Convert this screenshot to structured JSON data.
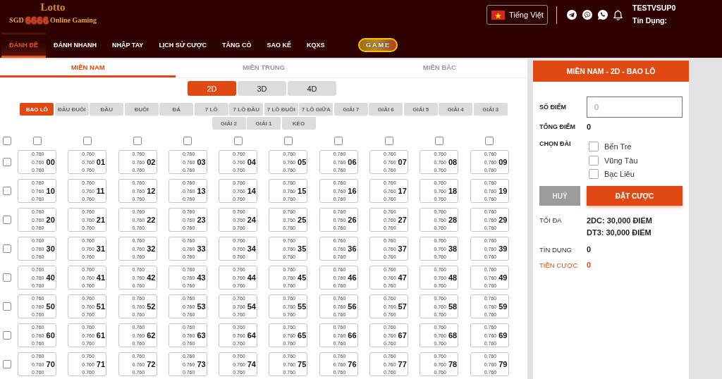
{
  "header": {
    "logo": {
      "title": "Lotto",
      "prefix": "SGD",
      "digits": "6666",
      "suffix": "Online Gaming"
    },
    "language": {
      "label": "Tiếng Việt"
    },
    "user": {
      "name": "TESTVSUP0",
      "credit": "Tín Dụng:"
    }
  },
  "nav": [
    {
      "label": "ĐÁNH ĐỀ",
      "kind": "link",
      "selected": true
    },
    {
      "label": "ĐÁNH NHANH",
      "kind": "link",
      "selected": false
    },
    {
      "label": "NHẬP TAY",
      "kind": "link",
      "selected": false
    },
    {
      "label": "LỊCH SỬ CƯỢC",
      "kind": "link",
      "selected": false
    },
    {
      "label": "TĂNG CÒ",
      "kind": "link",
      "selected": false
    },
    {
      "label": "SAO KÊ",
      "kind": "link",
      "selected": false
    },
    {
      "label": "KQXS",
      "kind": "link",
      "selected": false
    },
    {
      "label": "GAME",
      "kind": "pill",
      "selected": false
    }
  ],
  "regions": [
    {
      "label": "MIỀN NAM",
      "selected": true
    },
    {
      "label": "MIỀN TRUNG",
      "selected": false
    },
    {
      "label": "MIỀN BẮC",
      "selected": false
    }
  ],
  "digit_tabs": [
    {
      "label": "2D",
      "selected": true
    },
    {
      "label": "3D",
      "selected": false
    },
    {
      "label": "4D",
      "selected": false
    }
  ],
  "bet_types": [
    {
      "label": "BAO LÔ",
      "selected": true
    },
    {
      "label": "ĐẦU ĐUÔI",
      "selected": false
    },
    {
      "label": "ĐẦU",
      "selected": false
    },
    {
      "label": "ĐUÔI",
      "selected": false
    },
    {
      "label": "ĐÁ",
      "selected": false
    },
    {
      "label": "7 LÔ",
      "selected": false
    },
    {
      "label": "7 LÔ ĐẦU",
      "selected": false
    },
    {
      "label": "7 LÔ ĐUÔI",
      "selected": false
    },
    {
      "label": "7 LÔ GIỮA",
      "selected": false
    },
    {
      "label": "GIẢI 7",
      "selected": false
    },
    {
      "label": "GIẢI 6",
      "selected": false
    },
    {
      "label": "GIẢI 5",
      "selected": false
    },
    {
      "label": "GIẢI 4",
      "selected": false
    },
    {
      "label": "GIẢI 3",
      "selected": false
    },
    {
      "label": "GIẢI 2",
      "selected": false
    },
    {
      "label": "GIẢI 1",
      "selected": false
    },
    {
      "label": "KÉO",
      "selected": false
    }
  ],
  "grid": {
    "select_all": {
      "checked": false
    },
    "column_checks": [
      {
        "checked": false
      },
      {
        "checked": false
      },
      {
        "checked": false
      },
      {
        "checked": false
      },
      {
        "checked": false
      },
      {
        "checked": false
      },
      {
        "checked": false
      },
      {
        "checked": false
      },
      {
        "checked": false
      },
      {
        "checked": false
      }
    ],
    "rows": [
      {
        "checked": false,
        "cells": [
          {
            "odds": [
              "0.760",
              "0.760",
              "0.760"
            ],
            "number": "00"
          },
          {
            "odds": [
              "0.760",
              "0.760",
              "0.760"
            ],
            "number": "01"
          },
          {
            "odds": [
              "0.760",
              "0.760",
              "0.760"
            ],
            "number": "02"
          },
          {
            "odds": [
              "0.760",
              "0.760",
              "0.760"
            ],
            "number": "03"
          },
          {
            "odds": [
              "0.760",
              "0.760",
              "0.760"
            ],
            "number": "04"
          },
          {
            "odds": [
              "0.760",
              "0.760",
              "0.760"
            ],
            "number": "05"
          },
          {
            "odds": [
              "0.760",
              "0.760",
              "0.760"
            ],
            "number": "06"
          },
          {
            "odds": [
              "0.760",
              "0.760",
              "0.760"
            ],
            "number": "07"
          },
          {
            "odds": [
              "0.760",
              "0.760",
              "0.760"
            ],
            "number": "08"
          },
          {
            "odds": [
              "0.760",
              "0.760",
              "0.760"
            ],
            "number": "09"
          }
        ]
      },
      {
        "checked": false,
        "cells": [
          {
            "odds": [
              "0.760",
              "0.760",
              "0.760"
            ],
            "number": "10"
          },
          {
            "odds": [
              "0.760",
              "0.760",
              "0.760"
            ],
            "number": "11"
          },
          {
            "odds": [
              "0.760",
              "0.760",
              "0.760"
            ],
            "number": "12"
          },
          {
            "odds": [
              "0.760",
              "0.760",
              "0.760"
            ],
            "number": "13"
          },
          {
            "odds": [
              "0.760",
              "0.760",
              "0.760"
            ],
            "number": "14"
          },
          {
            "odds": [
              "0.760",
              "0.760",
              "0.760"
            ],
            "number": "15"
          },
          {
            "odds": [
              "0.760",
              "0.760",
              "0.760"
            ],
            "number": "16"
          },
          {
            "odds": [
              "0.760",
              "0.760",
              "0.760"
            ],
            "number": "17"
          },
          {
            "odds": [
              "0.760",
              "0.760",
              "0.760"
            ],
            "number": "18"
          },
          {
            "odds": [
              "0.760",
              "0.760",
              "0.760"
            ],
            "number": "19"
          }
        ]
      },
      {
        "checked": false,
        "cells": [
          {
            "odds": [
              "0.760",
              "0.760",
              "0.760"
            ],
            "number": "20"
          },
          {
            "odds": [
              "0.760",
              "0.760",
              "0.760"
            ],
            "number": "21"
          },
          {
            "odds": [
              "0.760",
              "0.760",
              "0.760"
            ],
            "number": "22"
          },
          {
            "odds": [
              "0.760",
              "0.760",
              "0.760"
            ],
            "number": "23"
          },
          {
            "odds": [
              "0.760",
              "0.760",
              "0.760"
            ],
            "number": "24"
          },
          {
            "odds": [
              "0.760",
              "0.760",
              "0.760"
            ],
            "number": "25"
          },
          {
            "odds": [
              "0.760",
              "0.760",
              "0.760"
            ],
            "number": "26"
          },
          {
            "odds": [
              "0.760",
              "0.760",
              "0.760"
            ],
            "number": "27"
          },
          {
            "odds": [
              "0.760",
              "0.760",
              "0.760"
            ],
            "number": "28"
          },
          {
            "odds": [
              "0.760",
              "0.760",
              "0.760"
            ],
            "number": "29"
          }
        ]
      },
      {
        "checked": false,
        "cells": [
          {
            "odds": [
              "0.760",
              "0.760",
              "0.760"
            ],
            "number": "30"
          },
          {
            "odds": [
              "0.760",
              "0.760",
              "0.760"
            ],
            "number": "31"
          },
          {
            "odds": [
              "0.760",
              "0.760",
              "0.760"
            ],
            "number": "32"
          },
          {
            "odds": [
              "0.760",
              "0.760",
              "0.760"
            ],
            "number": "33"
          },
          {
            "odds": [
              "0.760",
              "0.760",
              "0.760"
            ],
            "number": "34"
          },
          {
            "odds": [
              "0.760",
              "0.760",
              "0.760"
            ],
            "number": "35"
          },
          {
            "odds": [
              "0.760",
              "0.760",
              "0.760"
            ],
            "number": "36"
          },
          {
            "odds": [
              "0.760",
              "0.760",
              "0.760"
            ],
            "number": "37"
          },
          {
            "odds": [
              "0.760",
              "0.760",
              "0.760"
            ],
            "number": "38"
          },
          {
            "odds": [
              "0.760",
              "0.760",
              "0.760"
            ],
            "number": "39"
          }
        ]
      },
      {
        "checked": false,
        "cells": [
          {
            "odds": [
              "0.760",
              "0.760",
              "0.760"
            ],
            "number": "40"
          },
          {
            "odds": [
              "0.760",
              "0.760",
              "0.760"
            ],
            "number": "41"
          },
          {
            "odds": [
              "0.760",
              "0.760",
              "0.760"
            ],
            "number": "42"
          },
          {
            "odds": [
              "0.760",
              "0.760",
              "0.760"
            ],
            "number": "43"
          },
          {
            "odds": [
              "0.760",
              "0.760",
              "0.760"
            ],
            "number": "44"
          },
          {
            "odds": [
              "0.760",
              "0.760",
              "0.760"
            ],
            "number": "45"
          },
          {
            "odds": [
              "0.760",
              "0.760",
              "0.760"
            ],
            "number": "46"
          },
          {
            "odds": [
              "0.760",
              "0.760",
              "0.760"
            ],
            "number": "47"
          },
          {
            "odds": [
              "0.760",
              "0.760",
              "0.760"
            ],
            "number": "48"
          },
          {
            "odds": [
              "0.760",
              "0.760",
              "0.760"
            ],
            "number": "49"
          }
        ]
      },
      {
        "checked": false,
        "cells": [
          {
            "odds": [
              "0.760",
              "0.760",
              "0.760"
            ],
            "number": "50"
          },
          {
            "odds": [
              "0.760",
              "0.760",
              "0.760"
            ],
            "number": "51"
          },
          {
            "odds": [
              "0.760",
              "0.760",
              "0.760"
            ],
            "number": "52"
          },
          {
            "odds": [
              "0.760",
              "0.760",
              "0.760"
            ],
            "number": "53"
          },
          {
            "odds": [
              "0.760",
              "0.760",
              "0.760"
            ],
            "number": "54"
          },
          {
            "odds": [
              "0.760",
              "0.760",
              "0.760"
            ],
            "number": "55"
          },
          {
            "odds": [
              "0.760",
              "0.760",
              "0.760"
            ],
            "number": "56"
          },
          {
            "odds": [
              "0.760",
              "0.760",
              "0.760"
            ],
            "number": "57"
          },
          {
            "odds": [
              "0.760",
              "0.760",
              "0.760"
            ],
            "number": "58"
          },
          {
            "odds": [
              "0.760",
              "0.760",
              "0.760"
            ],
            "number": "59"
          }
        ]
      },
      {
        "checked": false,
        "cells": [
          {
            "odds": [
              "0.760",
              "0.760",
              "0.760"
            ],
            "number": "60"
          },
          {
            "odds": [
              "0.760",
              "0.760",
              "0.760"
            ],
            "number": "61"
          },
          {
            "odds": [
              "0.760",
              "0.760",
              "0.760"
            ],
            "number": "62"
          },
          {
            "odds": [
              "0.760",
              "0.760",
              "0.760"
            ],
            "number": "63"
          },
          {
            "odds": [
              "0.760",
              "0.760",
              "0.760"
            ],
            "number": "64"
          },
          {
            "odds": [
              "0.760",
              "0.760",
              "0.760"
            ],
            "number": "65"
          },
          {
            "odds": [
              "0.760",
              "0.760",
              "0.760"
            ],
            "number": "66"
          },
          {
            "odds": [
              "0.760",
              "0.760",
              "0.760"
            ],
            "number": "67"
          },
          {
            "odds": [
              "0.760",
              "0.760",
              "0.760"
            ],
            "number": "68"
          },
          {
            "odds": [
              "0.760",
              "0.760",
              "0.760"
            ],
            "number": "69"
          }
        ]
      },
      {
        "checked": false,
        "cells": [
          {
            "odds": [
              "0.760",
              "0.760",
              "0.760"
            ],
            "number": "70"
          },
          {
            "odds": [
              "0.760",
              "0.760",
              "0.760"
            ],
            "number": "71"
          },
          {
            "odds": [
              "0.760",
              "0.760",
              "0.760"
            ],
            "number": "72"
          },
          {
            "odds": [
              "0.760",
              "0.760",
              "0.760"
            ],
            "number": "73"
          },
          {
            "odds": [
              "0.760",
              "0.760",
              "0.760"
            ],
            "number": "74"
          },
          {
            "odds": [
              "0.760",
              "0.760",
              "0.760"
            ],
            "number": "75"
          },
          {
            "odds": [
              "0.760",
              "0.760",
              "0.760"
            ],
            "number": "76"
          },
          {
            "odds": [
              "0.760",
              "0.760",
              "0.760"
            ],
            "number": "77"
          },
          {
            "odds": [
              "0.760",
              "0.760",
              "0.760"
            ],
            "number": "78"
          },
          {
            "odds": [
              "0.760",
              "0.760",
              "0.760"
            ],
            "number": "79"
          }
        ]
      }
    ]
  },
  "bet_panel": {
    "title": "MIỀN NAM - 2D - BAO LÔ",
    "points": {
      "label": "SỐ ĐIỂM",
      "placeholder": "0"
    },
    "total_points": {
      "label": "TỔNG ĐIỂM",
      "value": "0"
    },
    "stations": {
      "label": "CHỌN ĐÀI",
      "options": [
        {
          "label": "Bến Tre",
          "checked": false
        },
        {
          "label": "Vũng Tàu",
          "checked": false
        },
        {
          "label": "Bạc Liêu",
          "checked": false
        }
      ]
    },
    "cancel_button": "HUỶ",
    "submit_button": "ĐẶT CƯỢC",
    "max": {
      "label": "TỐI ĐA",
      "values": [
        "2DC: 30,000 ĐIỂM",
        "DT3: 30,000 ĐIỂM"
      ]
    },
    "credit": {
      "label": "TÍN DỤNG",
      "value": "0"
    },
    "stake": {
      "label": "TIỀN CƯỢC",
      "value": "0"
    }
  }
}
